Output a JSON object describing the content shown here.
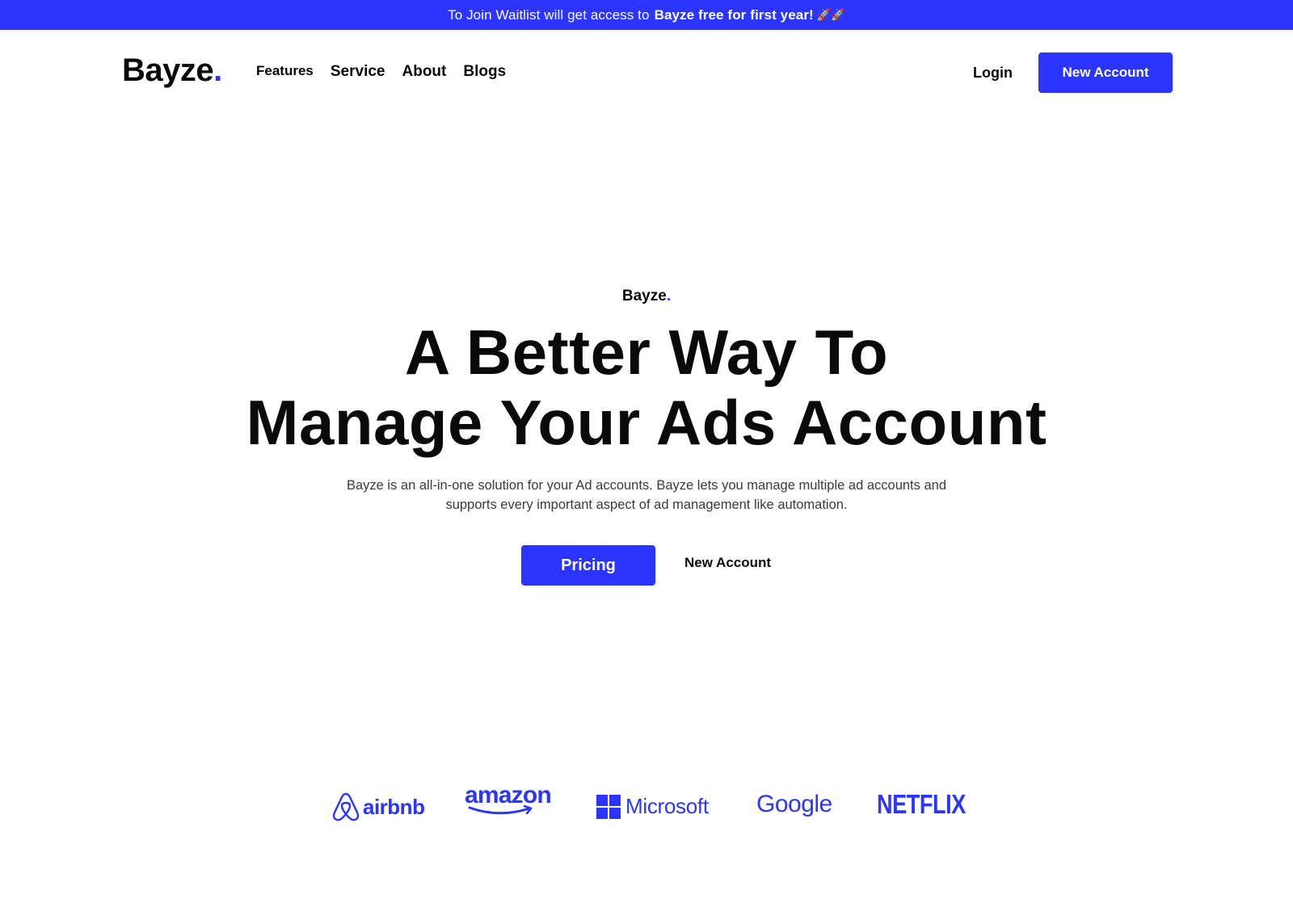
{
  "announcement": {
    "text": "To Join Waitlist will get access to",
    "highlight": "Bayze free for first year!",
    "emoji": "🚀🚀"
  },
  "nav": {
    "logo_text": "Bayze",
    "logo_dot": ".",
    "links": [
      "Features",
      "Service",
      "About",
      "Blogs"
    ],
    "login_label": "Login",
    "cta_label": "New Account"
  },
  "hero": {
    "brand_text": "Bayze",
    "brand_dot": ".",
    "title_line1": "A Better Way To",
    "title_line2": "Manage Your Ads Account",
    "subtitle_line1": "Bayze is an all-in-one solution for your Ad accounts. Bayze lets you manage multiple ad accounts and",
    "subtitle_line2": "supports every important aspect of ad management like automation.",
    "primary_button": "Pricing",
    "secondary_button": "New Account"
  },
  "partner_logos": {
    "airbnb": "airbnb",
    "amazon": "amazon",
    "microsoft": "Microsoft",
    "google": "Google",
    "netflix": "NETFLIX"
  },
  "colors": {
    "accent": "#2b35ff",
    "text": "#0a0a0a",
    "muted": "#3a3a3a",
    "background": "#ffffff"
  }
}
